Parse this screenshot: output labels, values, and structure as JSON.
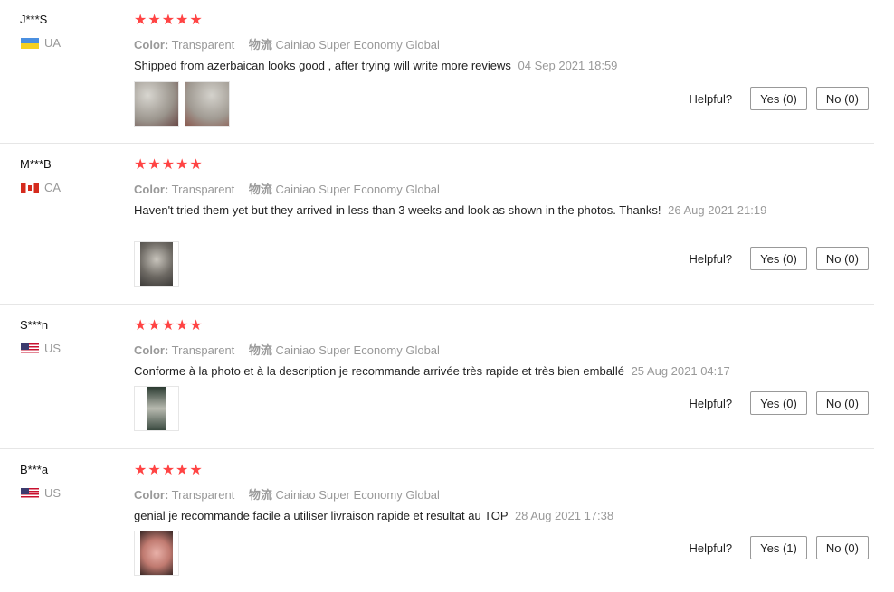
{
  "reviews": [
    {
      "user": "J***S",
      "country": "UA",
      "stars": "★★★★★",
      "color_label": "Color:",
      "color_value": "Transparent",
      "shipping_label": "物流",
      "shipping_value": "Cainiao Super Economy Global",
      "text": "Shipped from azerbaican looks good , after trying will write more reviews",
      "date": "04 Sep 2021 18:59",
      "helpful_label": "Helpful?",
      "yes": "Yes (0)",
      "no": "No (0)"
    },
    {
      "user": "M***B",
      "country": "CA",
      "stars": "★★★★★",
      "color_label": "Color:",
      "color_value": "Transparent",
      "shipping_label": "物流",
      "shipping_value": "Cainiao Super Economy Global",
      "text": "Haven't tried them yet but they arrived in less than 3 weeks and look as shown in the photos. Thanks!",
      "date": "26 Aug 2021 21:19",
      "helpful_label": "Helpful?",
      "yes": "Yes (0)",
      "no": "No (0)"
    },
    {
      "user": "S***n",
      "country": "US",
      "stars": "★★★★★",
      "color_label": "Color:",
      "color_value": "Transparent",
      "shipping_label": "物流",
      "shipping_value": "Cainiao Super Economy Global",
      "text": "Conforme à la photo et à la description je recommande arrivée très rapide et très bien emballé",
      "date": "25 Aug 2021 04:17",
      "helpful_label": "Helpful?",
      "yes": "Yes (0)",
      "no": "No (0)"
    },
    {
      "user": "B***a",
      "country": "US",
      "stars": "★★★★★",
      "color_label": "Color:",
      "color_value": "Transparent",
      "shipping_label": "物流",
      "shipping_value": "Cainiao Super Economy Global",
      "text": "genial je recommande facile a utiliser livraison rapide et resultat au TOP",
      "date": "28 Aug 2021 17:38",
      "helpful_label": "Helpful?",
      "yes": "Yes (1)",
      "no": "No (0)"
    }
  ]
}
